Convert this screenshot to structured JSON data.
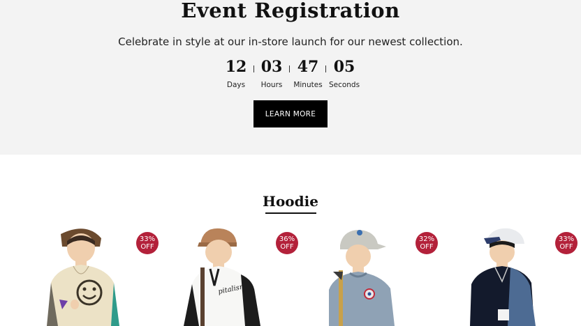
{
  "event": {
    "title": "Event Registration",
    "subtitle": "Celebrate in style at our in-store launch for our newest collection.",
    "countdown": [
      {
        "value": "12",
        "label": "Days"
      },
      {
        "value": "03",
        "label": "Hours"
      },
      {
        "value": "47",
        "label": "Minutes"
      },
      {
        "value": "05",
        "label": "Seconds"
      }
    ],
    "button_label": "LEARN MORE"
  },
  "collection": {
    "title": "Hoodie",
    "products": [
      {
        "discount_pct": "33%",
        "discount_off": "OFF"
      },
      {
        "discount_pct": "36%",
        "discount_off": "OFF"
      },
      {
        "discount_pct": "32%",
        "discount_off": "OFF"
      },
      {
        "discount_pct": "33%",
        "discount_off": "OFF"
      }
    ]
  },
  "colors": {
    "section_bg": "#f3f3f3",
    "badge": "#b3213a",
    "button": "#000000"
  }
}
